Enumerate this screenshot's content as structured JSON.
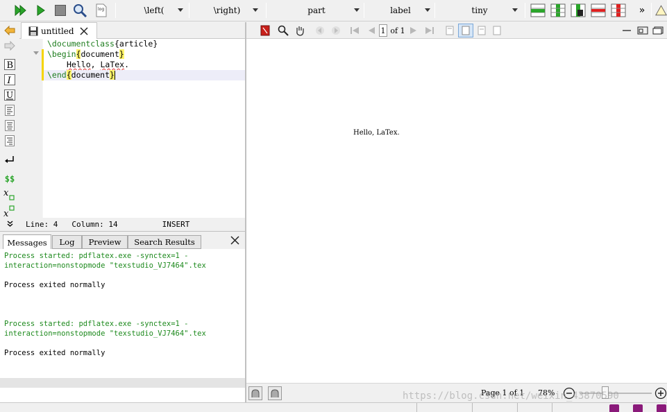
{
  "toolbar": {
    "combos": [
      {
        "label": "\\left("
      },
      {
        "label": "\\right)"
      },
      {
        "label": "part"
      },
      {
        "label": "label"
      },
      {
        "label": "tiny"
      }
    ],
    "more": "»"
  },
  "editor": {
    "tab_label": "untitled",
    "lines": [
      {
        "cmd": "\\documentclass",
        "arg": "{article}"
      },
      {
        "cmd": "\\begin",
        "arg": "document"
      },
      {
        "text1": "Hello",
        "text2": ", ",
        "text3": "LaTex",
        "text4": "."
      },
      {
        "cmd": "\\end",
        "arg": "document"
      }
    ],
    "status": {
      "line": "Line: 4",
      "column": "Column: 14",
      "mode": "INSERT"
    }
  },
  "messages": {
    "tabs": [
      "Messages",
      "Log",
      "Preview",
      "Search Results"
    ],
    "lines": [
      {
        "text": "Process started: pdflatex.exe -synctex=1 -",
        "color": "green"
      },
      {
        "text": "interaction=nonstopmode \"texstudio_VJ7464\".tex",
        "color": "green"
      },
      {
        "text": "Process exited normally",
        "color": "black"
      },
      {
        "text": "Process started: pdflatex.exe -synctex=1 -",
        "color": "green"
      },
      {
        "text": "interaction=nonstopmode \"texstudio_VJ7464\".tex",
        "color": "green"
      },
      {
        "text": "Process exited normally",
        "color": "black"
      }
    ]
  },
  "pdf": {
    "page_input": "1",
    "page_of": "of 1",
    "content": "Hello, LaTex.",
    "page_status": "Page 1 of 1",
    "zoom": "78%"
  },
  "colors": {
    "keyword": "#1e7d1e",
    "brace_highlight": "#fff46b",
    "message_green": "#1e8a1e",
    "run_green": "#2aa52a"
  },
  "watermark": "https://blog.csdn.net/weixin_43870590"
}
